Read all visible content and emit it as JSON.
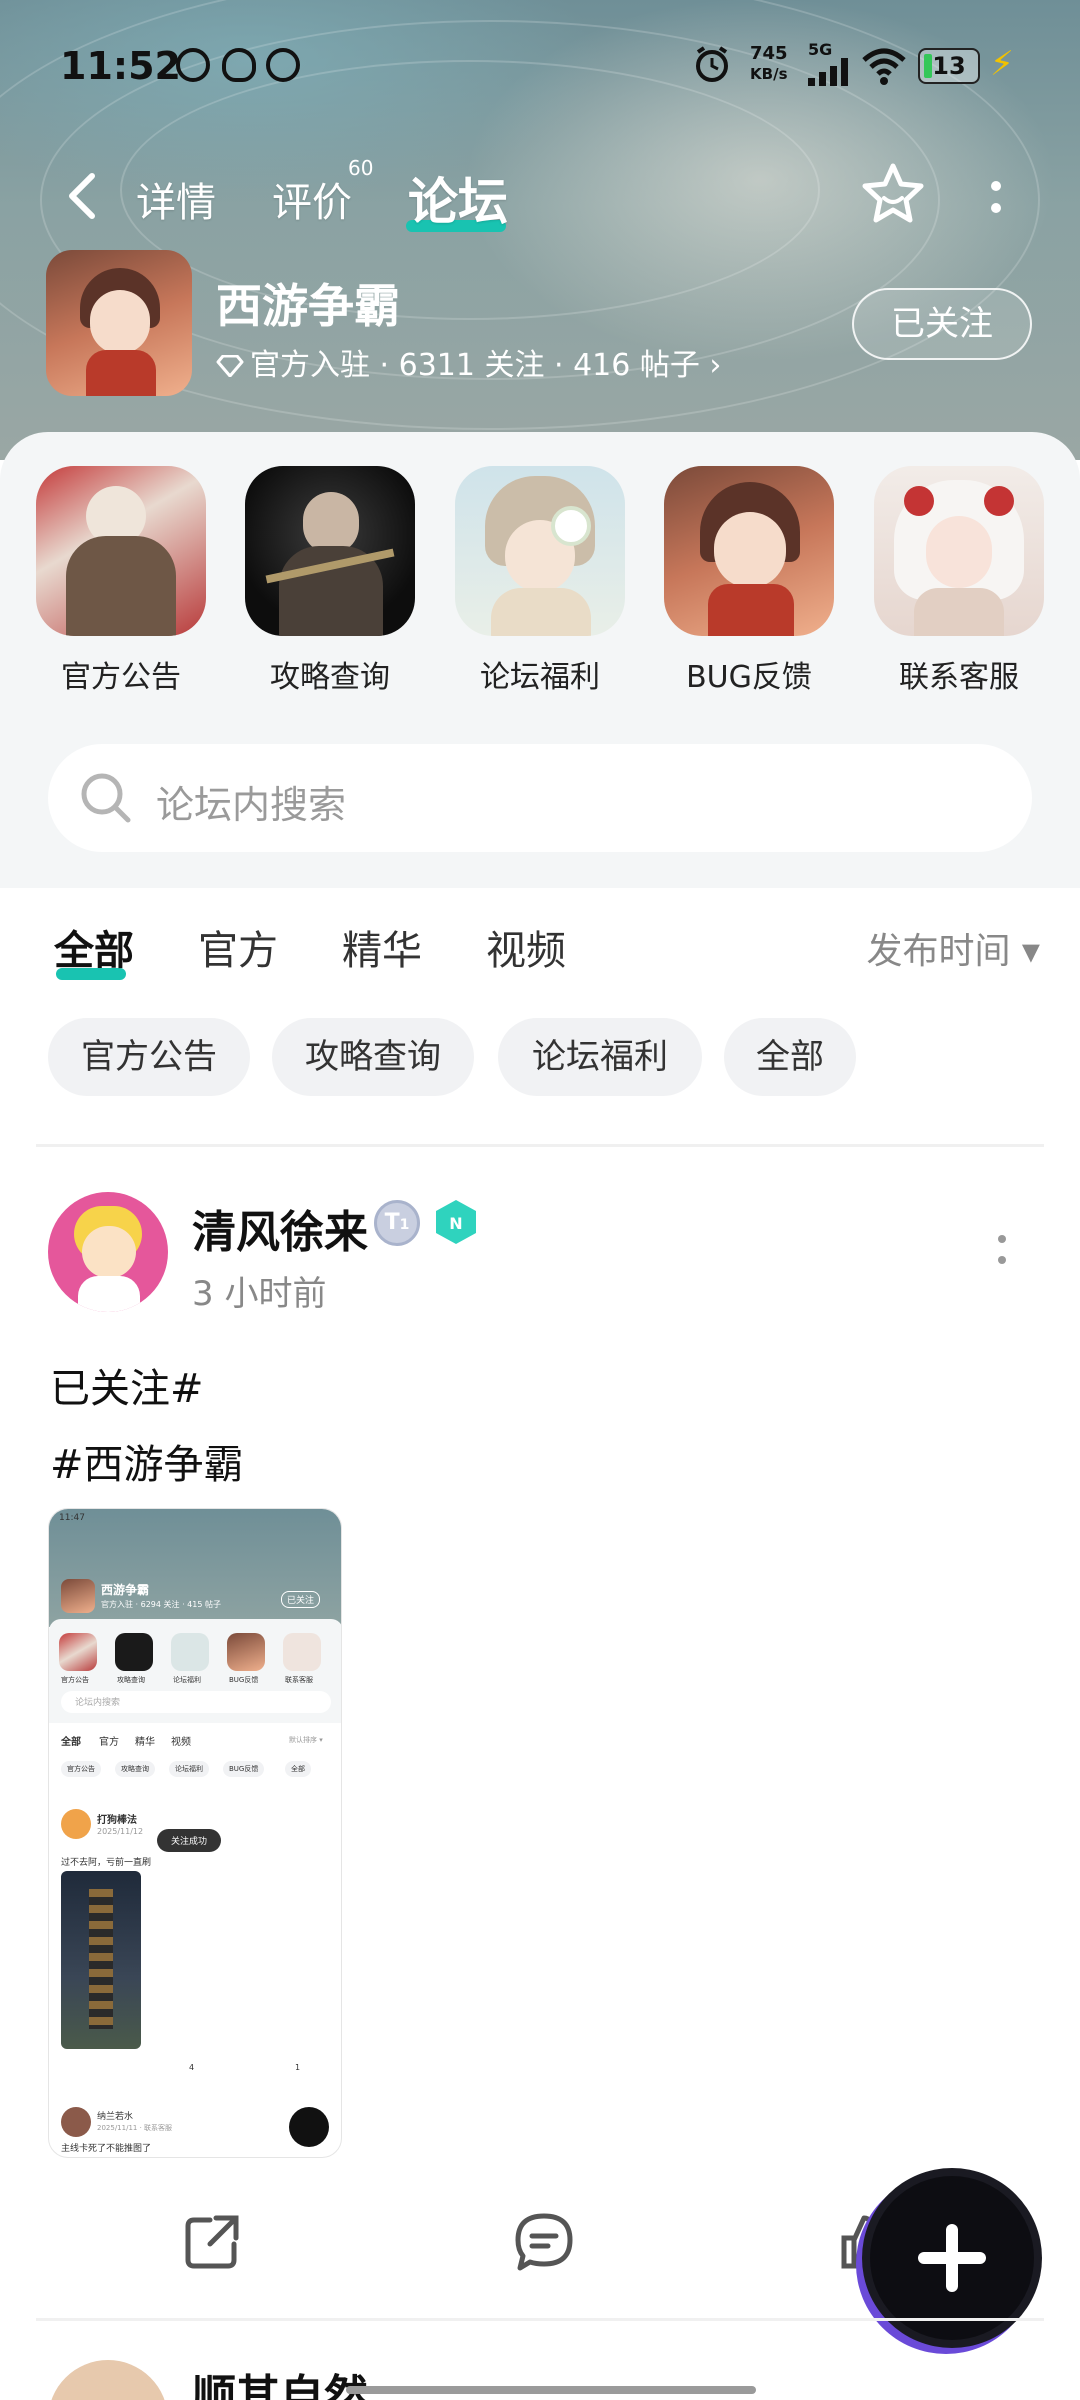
{
  "status_bar": {
    "time": "11:52",
    "speed_value": "745",
    "speed_unit": "KB/s",
    "network": "5G",
    "battery": "13"
  },
  "top_nav": {
    "tabs": [
      {
        "label": "详情"
      },
      {
        "label": "评价",
        "badge": "60"
      },
      {
        "label": "论坛"
      }
    ]
  },
  "game": {
    "title": "西游争霸",
    "meta": "官方入驻 · 6311 关注 · 416 帖子 ›",
    "follow_label": "已关注"
  },
  "categories": [
    {
      "label": "官方公告"
    },
    {
      "label": "攻略查询"
    },
    {
      "label": "论坛福利"
    },
    {
      "label": "BUG反馈"
    },
    {
      "label": "联系客服"
    }
  ],
  "search": {
    "placeholder": "论坛内搜索"
  },
  "filter_tabs": [
    {
      "label": "全部"
    },
    {
      "label": "官方"
    },
    {
      "label": "精华"
    },
    {
      "label": "视频"
    }
  ],
  "sort_label": "发布时间 ▾",
  "chips": [
    {
      "label": "官方公告"
    },
    {
      "label": "攻略查询"
    },
    {
      "label": "论坛福利"
    },
    {
      "label": "全部"
    }
  ],
  "post": {
    "username": "清风徐来",
    "badge_level": "1",
    "time": "3 小时前",
    "text_line1": "已关注#",
    "text_line2": "#西游争霸",
    "screenshot": {
      "time": "11:47",
      "title": "西游争霸",
      "meta": "官方入驻 · 6294 关注 · 415 帖子",
      "follow": "已关注",
      "cats": [
        "官方公告",
        "攻略查询",
        "论坛福利",
        "BUG反馈",
        "联系客服"
      ],
      "search": "论坛内搜索",
      "tabs": [
        "全部",
        "官方",
        "精华",
        "视频"
      ],
      "sort": "默认排序 ▾",
      "chips": [
        "官方公告",
        "攻略查询",
        "论坛福利",
        "BUG反馈",
        "全部"
      ],
      "user": "打狗棒法",
      "date": "2025/11/12",
      "toast": "关注成功",
      "text": "过不去阿，亏前一直刷",
      "comments": "4",
      "likes": "1",
      "user2": "纳兰若水",
      "date2": "2025/11/11 · 联系客服",
      "text2": "主线卡死了不能推图了"
    }
  },
  "next_post": {
    "username": "顺其自然"
  }
}
